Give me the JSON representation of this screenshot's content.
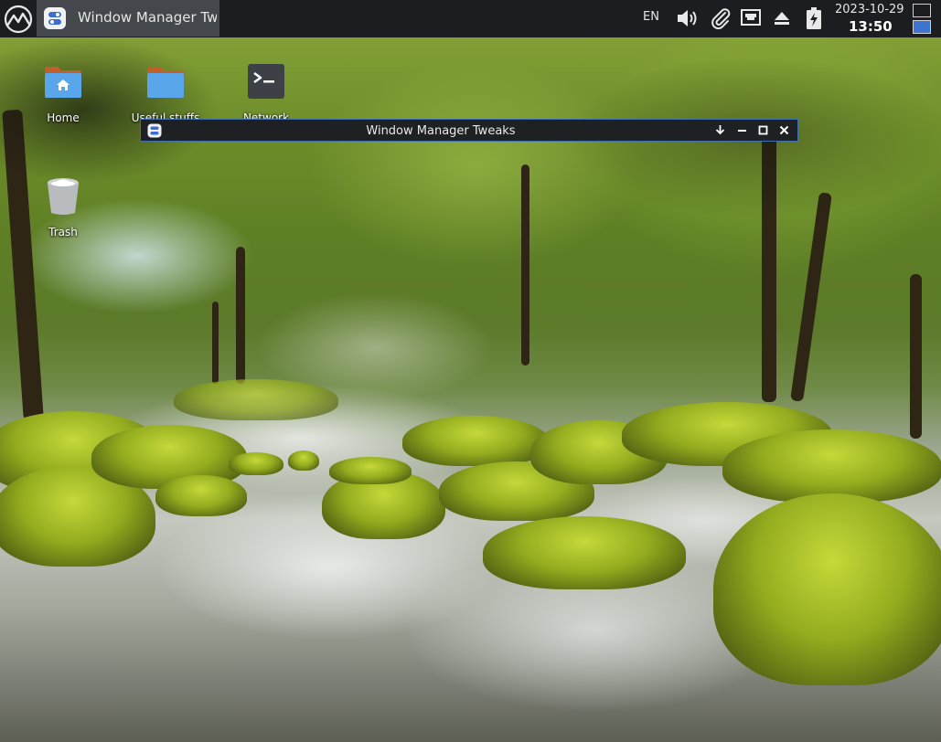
{
  "panel": {
    "active_task_title": "Window Manager Tw...",
    "language": "EN",
    "date": "2023-10-29",
    "time": "13:50",
    "workspaces": [
      "workspace-1",
      "workspace-2"
    ],
    "active_workspace": "workspace-2",
    "tray_icons": [
      "volume-icon",
      "paperclip-icon",
      "network-wired-icon",
      "eject-icon",
      "battery-charging-icon"
    ]
  },
  "desktop": {
    "icons": [
      {
        "label": "Home",
        "icon": "home-folder-icon"
      },
      {
        "label": "Useful stuffs",
        "icon": "folder-icon"
      },
      {
        "label": "Network",
        "icon": "terminal-icon"
      },
      {
        "label": "Trash",
        "icon": "trash-icon"
      }
    ]
  },
  "window": {
    "title": "Window Manager Tweaks",
    "buttons": [
      "shade-button",
      "minimize-button",
      "maximize-button",
      "close-button"
    ]
  },
  "colors": {
    "panel_bg": "#1b1d21",
    "active_task_bg": "#44474c",
    "window_border": "#3f6fb0",
    "folder_blue": "#5aa6ea",
    "folder_tab": "#c0602a",
    "workspace_active": "#3d74cf"
  }
}
